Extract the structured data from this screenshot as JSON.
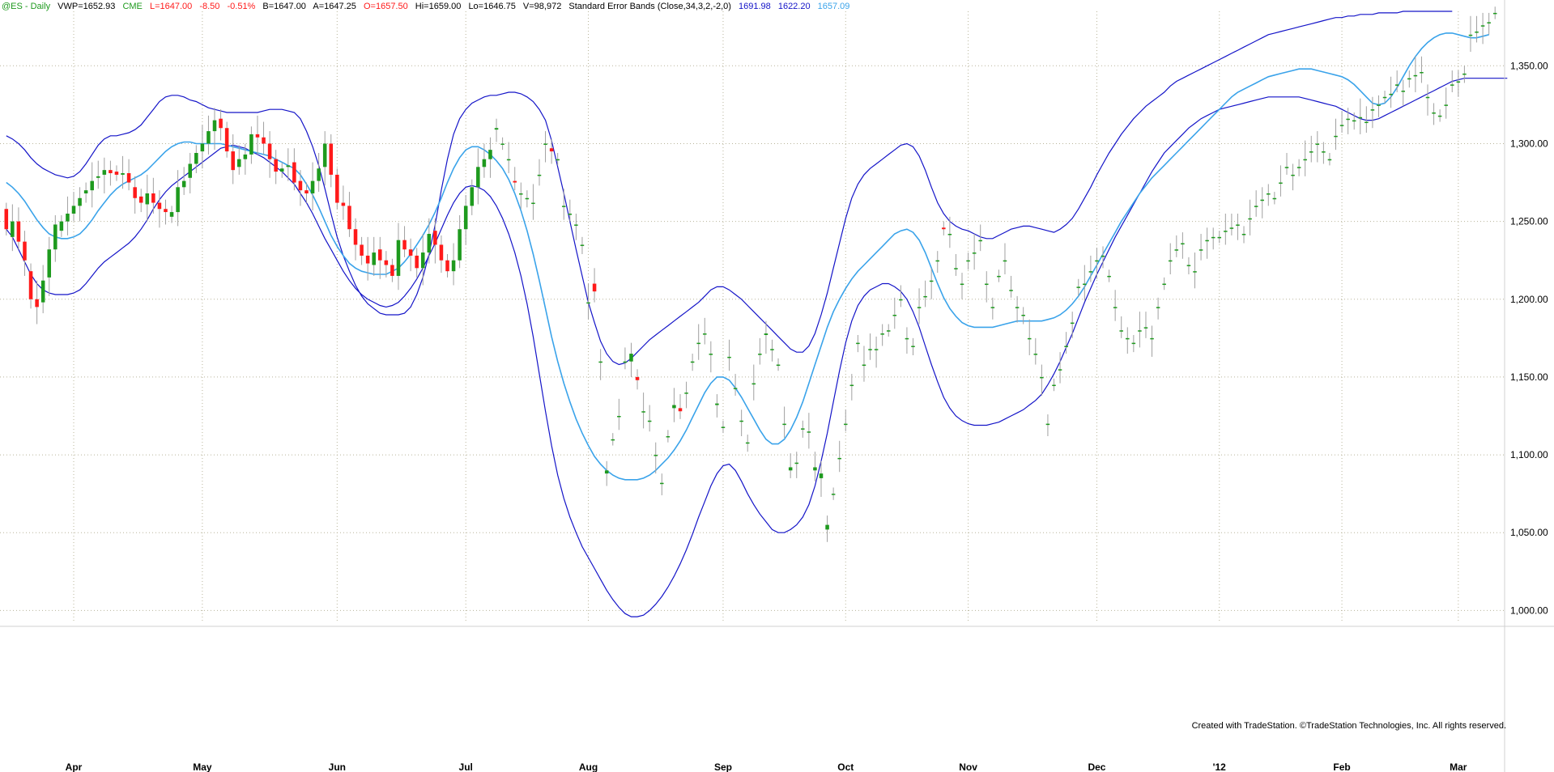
{
  "header": {
    "symbol": "@ES - Daily",
    "vwp": "VWP=1652.93",
    "exchange": "CME",
    "last": "L=1647.00",
    "change": "-8.50",
    "change_pct": "-0.51%",
    "bid": "B=1647.00",
    "ask": "A=1647.25",
    "open": "O=1657.50",
    "high": "Hi=1659.00",
    "low": "Lo=1646.75",
    "volume": "V=98,972",
    "indicator": "Standard Error Bands (Close,34,3,2,-2,0)",
    "upper_val": "1691.98",
    "lower_val": "1622.20",
    "mid_val": "1657.09"
  },
  "colors": {
    "up": "#1e9a1e",
    "down": "#ff1a1a",
    "wick": "#a0a0a0",
    "band": "#1414c8",
    "mid": "#3aa3ea",
    "grid": "#b8b49a",
    "header_green": "#1e9a1e",
    "header_red": "#ff1a1a",
    "header_blue": "#1414c8",
    "header_cyan": "#3aa3ea"
  },
  "watermark": "Created with TradeStation. ©TradeStation Technologies, Inc. All rights reserved.",
  "chart_data": {
    "type": "candlestick",
    "ylim": [
      995,
      1385
    ],
    "y_ticks": [
      1000,
      1050,
      1100,
      1150,
      1200,
      1250,
      1300,
      1350
    ],
    "y_tick_labels": [
      "1,000.00",
      "1,050.00",
      "1,100.00",
      "1,150.00",
      "1,200.00",
      "1,250.00",
      "1,300.00",
      "1,350.00"
    ],
    "x_labels": [
      {
        "label": "Apr",
        "index": 11
      },
      {
        "label": "May",
        "index": 32
      },
      {
        "label": "Jun",
        "index": 54
      },
      {
        "label": "Jul",
        "index": 75
      },
      {
        "label": "Aug",
        "index": 95
      },
      {
        "label": "Sep",
        "index": 117
      },
      {
        "label": "Oct",
        "index": 137
      },
      {
        "label": "Nov",
        "index": 157
      },
      {
        "label": "Dec",
        "index": 178
      },
      {
        "label": "'12",
        "index": 198
      },
      {
        "label": "Feb",
        "index": 218
      },
      {
        "label": "Mar",
        "index": 237
      }
    ],
    "candles_close": [
      1245,
      1250,
      1237,
      1225,
      1200,
      1195,
      1212,
      1232,
      1248,
      1250,
      1255,
      1260,
      1265,
      1270,
      1276,
      1279,
      1283,
      1281,
      1280,
      1281,
      1275,
      1265,
      1262,
      1268,
      1262,
      1258,
      1256,
      1256,
      1272,
      1276,
      1287,
      1294,
      1300,
      1308,
      1315,
      1310,
      1295,
      1283,
      1290,
      1293,
      1306,
      1304,
      1300,
      1290,
      1282,
      1284,
      1286,
      1275,
      1270,
      1268,
      1276,
      1284,
      1300,
      1280,
      1262,
      1260,
      1245,
      1235,
      1228,
      1223,
      1230,
      1225,
      1222,
      1215,
      1238,
      1232,
      1228,
      1220,
      1230,
      1242,
      1235,
      1225,
      1218,
      1225,
      1245,
      1260,
      1272,
      1285,
      1290,
      1296,
      1310,
      1300,
      1290,
      1275,
      1268,
      1265,
      1262,
      1280,
      1300,
      1295,
      1290,
      1260,
      1255,
      1248,
      1235,
      1198,
      1205,
      1160,
      1090,
      1110,
      1125,
      1160,
      1165,
      1148,
      1128,
      1122,
      1100,
      1082,
      1112,
      1132,
      1128,
      1140,
      1160,
      1172,
      1178,
      1165,
      1133,
      1118,
      1163,
      1143,
      1122,
      1108,
      1146,
      1165,
      1178,
      1168,
      1158,
      1120,
      1092,
      1095,
      1117,
      1115,
      1092,
      1088,
      1055,
      1075,
      1098,
      1120,
      1145,
      1172,
      1158,
      1168,
      1168,
      1178,
      1180,
      1190,
      1200,
      1175,
      1170,
      1195,
      1202,
      1212,
      1225,
      1245,
      1242,
      1220,
      1210,
      1225,
      1230,
      1238,
      1210,
      1195,
      1215,
      1225,
      1206,
      1195,
      1190,
      1175,
      1165,
      1150,
      1120,
      1145,
      1155,
      1170,
      1185,
      1208,
      1210,
      1218,
      1225,
      1228,
      1215,
      1195,
      1180,
      1175,
      1172,
      1180,
      1182,
      1175,
      1195,
      1210,
      1225,
      1232,
      1236,
      1222,
      1218,
      1232,
      1238,
      1240,
      1240,
      1244,
      1246,
      1248,
      1242,
      1252,
      1260,
      1264,
      1268,
      1265,
      1275,
      1285,
      1280,
      1285,
      1290,
      1295,
      1300,
      1295,
      1290,
      1305,
      1312,
      1316,
      1315,
      1317,
      1314,
      1322,
      1325,
      1330,
      1332,
      1338,
      1334,
      1342,
      1344,
      1346,
      1330,
      1320,
      1318,
      1325,
      1338,
      1340,
      1345,
      1370,
      1372,
      1376,
      1378,
      1384
    ],
    "candles_open": [
      1258,
      1240,
      1250,
      1237,
      1218,
      1200,
      1198,
      1214,
      1232,
      1244,
      1250,
      1255,
      1260,
      1268,
      1270,
      1278,
      1280,
      1283,
      1282,
      1280,
      1281,
      1272,
      1266,
      1261,
      1268,
      1262,
      1258,
      1253,
      1256,
      1272,
      1278,
      1287,
      1295,
      1300,
      1308,
      1316,
      1310,
      1295,
      1285,
      1290,
      1293,
      1306,
      1304,
      1300,
      1290,
      1282,
      1285,
      1288,
      1276,
      1270,
      1268,
      1276,
      1285,
      1300,
      1280,
      1262,
      1260,
      1245,
      1235,
      1228,
      1222,
      1232,
      1225,
      1222,
      1215,
      1238,
      1232,
      1228,
      1220,
      1230,
      1244,
      1235,
      1225,
      1218,
      1225,
      1245,
      1260,
      1272,
      1285,
      1290,
      1309,
      1300,
      1290,
      1276,
      1268,
      1265,
      1262,
      1280,
      1300,
      1297,
      1290,
      1260,
      1255,
      1248,
      1235,
      1198,
      1210,
      1160,
      1088,
      1110,
      1125,
      1160,
      1160,
      1150,
      1128,
      1122,
      1100,
      1082,
      1112,
      1130,
      1130,
      1140,
      1160,
      1172,
      1178,
      1165,
      1132,
      1118,
      1163,
      1143,
      1122,
      1108,
      1146,
      1165,
      1177,
      1168,
      1158,
      1120,
      1090,
      1095,
      1117,
      1115,
      1090,
      1085,
      1052,
      1075,
      1098,
      1120,
      1145,
      1172,
      1158,
      1168,
      1168,
      1178,
      1180,
      1190,
      1200,
      1175,
      1170,
      1195,
      1202,
      1212,
      1225,
      1246,
      1242,
      1220,
      1210,
      1225,
      1230,
      1238,
      1210,
      1195,
      1215,
      1225,
      1206,
      1195,
      1190,
      1175,
      1165,
      1150,
      1120,
      1145,
      1155,
      1170,
      1185,
      1208,
      1210,
      1218,
      1225,
      1228,
      1215,
      1195,
      1180,
      1175,
      1172,
      1180,
      1182,
      1175,
      1195,
      1210,
      1225,
      1232,
      1236,
      1222,
      1218,
      1232,
      1238,
      1240,
      1240,
      1244,
      1246,
      1248,
      1242,
      1252,
      1260,
      1264,
      1268,
      1265,
      1275,
      1285,
      1280,
      1285,
      1290,
      1295,
      1300,
      1295,
      1290,
      1305,
      1312,
      1316,
      1315,
      1317,
      1314,
      1322,
      1325,
      1330,
      1332,
      1338,
      1334,
      1342,
      1344,
      1346,
      1330,
      1320,
      1318,
      1325,
      1338,
      1340,
      1345,
      1370,
      1372,
      1376,
      1378
    ],
    "upper_band": [
      1305,
      1303,
      1300,
      1296,
      1291,
      1287,
      1284,
      1282,
      1280,
      1279,
      1278,
      1279,
      1282,
      1287,
      1293,
      1299,
      1303,
      1305,
      1305,
      1306,
      1307,
      1309,
      1312,
      1317,
      1322,
      1327,
      1330,
      1331,
      1331,
      1330,
      1328,
      1327,
      1325,
      1323,
      1322,
      1321,
      1320,
      1320,
      1320,
      1320,
      1320,
      1320,
      1321,
      1322,
      1322,
      1322,
      1321,
      1320,
      1316,
      1308,
      1298,
      1286,
      1271,
      1255,
      1240,
      1228,
      1218,
      1209,
      1202,
      1197,
      1194,
      1191,
      1190,
      1190,
      1190,
      1191,
      1195,
      1203,
      1214,
      1229,
      1248,
      1270,
      1290,
      1306,
      1316,
      1322,
      1326,
      1328,
      1330,
      1331,
      1331,
      1332,
      1333,
      1333,
      1332,
      1330,
      1327,
      1322,
      1315,
      1302,
      1285,
      1268,
      1250,
      1232,
      1215,
      1198,
      1185,
      1173,
      1165,
      1160,
      1158,
      1159,
      1162,
      1166,
      1170,
      1174,
      1177,
      1180,
      1183,
      1186,
      1189,
      1192,
      1195,
      1198,
      1202,
      1206,
      1208,
      1208,
      1206,
      1203,
      1200,
      1196,
      1192,
      1188,
      1184,
      1180,
      1176,
      1172,
      1168,
      1166,
      1166,
      1170,
      1178,
      1190,
      1204,
      1220,
      1236,
      1252,
      1265,
      1274,
      1280,
      1284,
      1287,
      1290,
      1293,
      1296,
      1299,
      1300,
      1298,
      1292,
      1283,
      1272,
      1262,
      1255,
      1250,
      1247,
      1245,
      1244,
      1242,
      1240,
      1239,
      1239,
      1241,
      1243,
      1245,
      1246,
      1247,
      1247,
      1246,
      1245,
      1244,
      1243,
      1245,
      1248,
      1252,
      1258,
      1265,
      1272,
      1280,
      1287,
      1294,
      1300,
      1306,
      1311,
      1316,
      1320,
      1324,
      1327,
      1330,
      1333,
      1337,
      1340,
      1342,
      1344,
      1346,
      1348,
      1350,
      1352,
      1354,
      1356,
      1358,
      1360,
      1362,
      1364,
      1366,
      1368,
      1370,
      1371,
      1372,
      1373,
      1374,
      1375,
      1376,
      1377,
      1378,
      1379,
      1380,
      1381,
      1381,
      1382,
      1382,
      1383,
      1383,
      1383,
      1384,
      1384,
      1384,
      1384,
      1385,
      1385,
      1385,
      1385,
      1385,
      1385,
      1385,
      1385,
      1385
    ],
    "mid_band": [
      1275,
      1272,
      1268,
      1263,
      1257,
      1251,
      1246,
      1242,
      1240,
      1239,
      1239,
      1240,
      1242,
      1246,
      1251,
      1257,
      1262,
      1267,
      1271,
      1274,
      1276,
      1278,
      1280,
      1283,
      1287,
      1291,
      1295,
      1298,
      1300,
      1301,
      1301,
      1300,
      1300,
      1300,
      1300,
      1300,
      1299,
      1298,
      1297,
      1296,
      1295,
      1294,
      1293,
      1292,
      1290,
      1288,
      1286,
      1284,
      1280,
      1274,
      1267,
      1259,
      1250,
      1241,
      1234,
      1228,
      1223,
      1220,
      1218,
      1217,
      1216,
      1216,
      1216,
      1218,
      1220,
      1224,
      1229,
      1235,
      1241,
      1248,
      1256,
      1265,
      1275,
      1284,
      1291,
      1296,
      1298,
      1298,
      1296,
      1293,
      1289,
      1284,
      1277,
      1268,
      1257,
      1244,
      1229,
      1212,
      1194,
      1176,
      1160,
      1146,
      1134,
      1123,
      1114,
      1106,
      1099,
      1094,
      1090,
      1087,
      1085,
      1084,
      1084,
      1084,
      1085,
      1087,
      1090,
      1094,
      1098,
      1103,
      1109,
      1116,
      1124,
      1132,
      1140,
      1146,
      1150,
      1150,
      1148,
      1143,
      1137,
      1130,
      1123,
      1116,
      1110,
      1107,
      1107,
      1110,
      1116,
      1124,
      1134,
      1146,
      1158,
      1170,
      1182,
      1192,
      1200,
      1207,
      1213,
      1218,
      1222,
      1226,
      1230,
      1234,
      1238,
      1242,
      1244,
      1245,
      1243,
      1238,
      1230,
      1220,
      1210,
      1201,
      1194,
      1189,
      1185,
      1183,
      1182,
      1182,
      1182,
      1182,
      1183,
      1184,
      1185,
      1186,
      1186,
      1186,
      1186,
      1186,
      1187,
      1188,
      1190,
      1193,
      1197,
      1202,
      1208,
      1215,
      1222,
      1229,
      1236,
      1243,
      1250,
      1256,
      1262,
      1268,
      1273,
      1278,
      1282,
      1286,
      1290,
      1294,
      1298,
      1302,
      1306,
      1310,
      1314,
      1318,
      1322,
      1326,
      1330,
      1333,
      1335,
      1337,
      1339,
      1341,
      1343,
      1344,
      1345,
      1346,
      1347,
      1348,
      1348,
      1348,
      1347,
      1346,
      1345,
      1344,
      1343,
      1341,
      1338,
      1334,
      1330,
      1326,
      1325,
      1326,
      1330,
      1336,
      1343,
      1350,
      1356,
      1361,
      1365,
      1368,
      1370,
      1371,
      1371,
      1370,
      1369,
      1368,
      1368,
      1369,
      1370
    ],
    "lower_band": [
      1245,
      1240,
      1232,
      1224,
      1216,
      1210,
      1206,
      1204,
      1203,
      1203,
      1203,
      1204,
      1206,
      1210,
      1215,
      1220,
      1224,
      1227,
      1230,
      1233,
      1236,
      1240,
      1245,
      1251,
      1258,
      1264,
      1269,
      1273,
      1276,
      1279,
      1282,
      1285,
      1288,
      1291,
      1294,
      1297,
      1298,
      1299,
      1298,
      1297,
      1295,
      1293,
      1291,
      1288,
      1285,
      1282,
      1278,
      1274,
      1268,
      1262,
      1255,
      1247,
      1239,
      1232,
      1225,
      1218,
      1212,
      1207,
      1203,
      1200,
      1198,
      1196,
      1195,
      1196,
      1198,
      1202,
      1207,
      1213,
      1220,
      1228,
      1236,
      1245,
      1254,
      1262,
      1268,
      1272,
      1273,
      1272,
      1270,
      1266,
      1260,
      1252,
      1242,
      1230,
      1215,
      1197,
      1176,
      1152,
      1128,
      1106,
      1087,
      1072,
      1060,
      1050,
      1041,
      1034,
      1027,
      1020,
      1013,
      1007,
      1002,
      998,
      996,
      996,
      997,
      1000,
      1004,
      1009,
      1015,
      1022,
      1030,
      1039,
      1049,
      1060,
      1070,
      1080,
      1088,
      1093,
      1094,
      1090,
      1083,
      1075,
      1068,
      1062,
      1057,
      1052,
      1050,
      1050,
      1052,
      1055,
      1060,
      1068,
      1080,
      1096,
      1114,
      1134,
      1154,
      1172,
      1186,
      1196,
      1202,
      1206,
      1208,
      1210,
      1210,
      1208,
      1205,
      1200,
      1192,
      1182,
      1170,
      1158,
      1147,
      1137,
      1130,
      1125,
      1122,
      1120,
      1119,
      1119,
      1119,
      1120,
      1121,
      1123,
      1125,
      1127,
      1129,
      1132,
      1135,
      1139,
      1145,
      1152,
      1160,
      1169,
      1178,
      1188,
      1198,
      1207,
      1216,
      1224,
      1232,
      1240,
      1247,
      1254,
      1261,
      1268,
      1275,
      1282,
      1288,
      1294,
      1298,
      1302,
      1306,
      1310,
      1313,
      1316,
      1318,
      1320,
      1322,
      1323,
      1324,
      1325,
      1326,
      1327,
      1328,
      1329,
      1330,
      1330,
      1330,
      1330,
      1330,
      1330,
      1329,
      1328,
      1327,
      1326,
      1325,
      1324,
      1322,
      1320,
      1318,
      1316,
      1315,
      1315,
      1316,
      1318,
      1320,
      1322,
      1324,
      1326,
      1328,
      1330,
      1332,
      1334,
      1336,
      1338,
      1340,
      1341,
      1342,
      1342,
      1342,
      1342,
      1342,
      1342,
      1342,
      1342
    ]
  }
}
